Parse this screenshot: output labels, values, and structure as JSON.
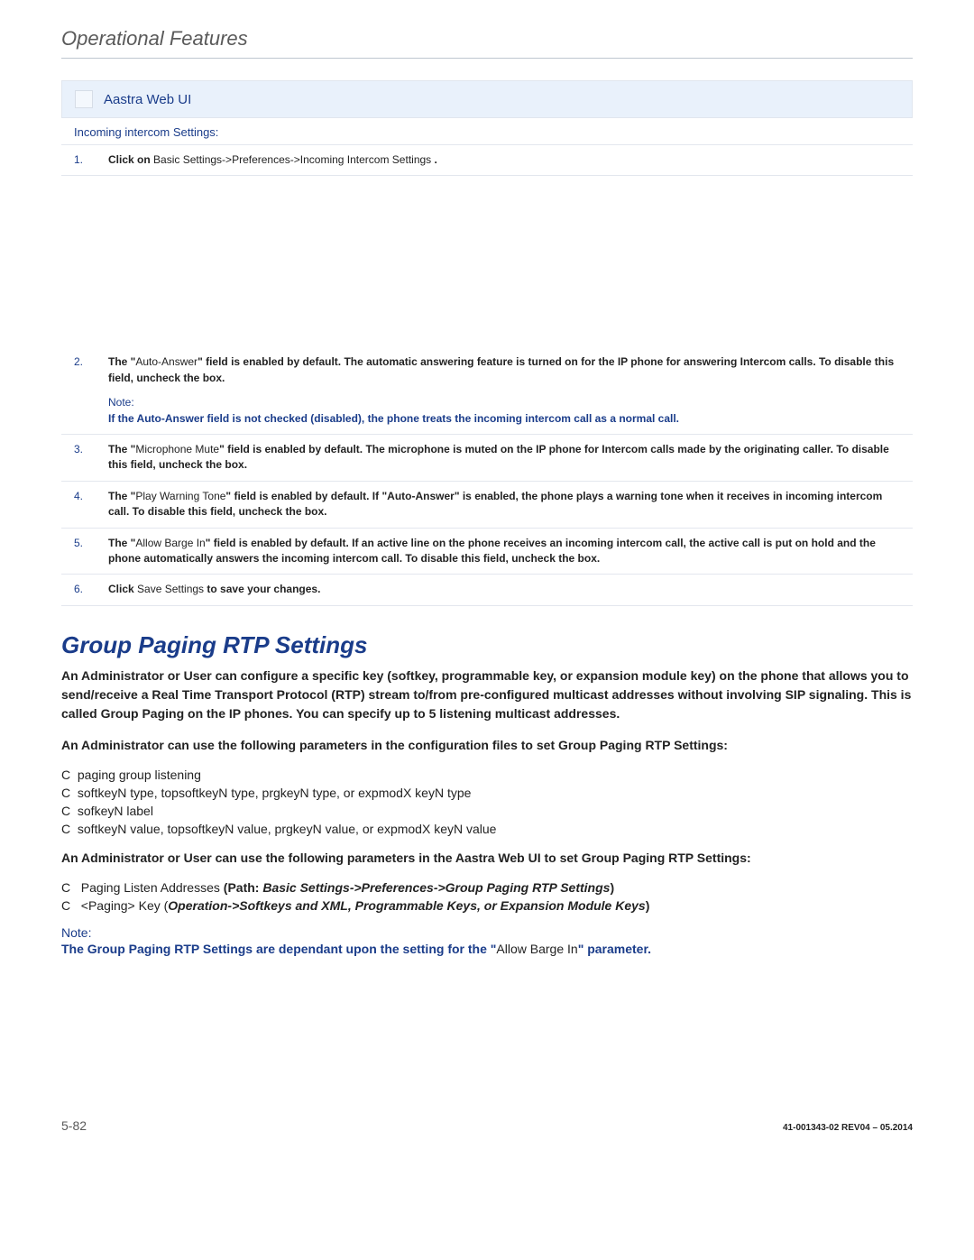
{
  "header": {
    "title": "Operational Features"
  },
  "panel": {
    "title": "Aastra Web UI",
    "subhead": "Incoming intercom Settings:"
  },
  "steps": [
    {
      "num": "1.",
      "html": "<b>Click on</b> Basic Settings->Preferences->Incoming Intercom Settings<b>&nbsp;.</b>"
    },
    {
      "num": "2.",
      "html": "<b>The \"</b>Auto-Answer<b>\" field is enabled by default. The automatic answering feature is turned on for the IP phone for answering Intercom calls. To disable this field, uncheck the box.</b>",
      "noteLabel": "Note:",
      "noteText": "If the Auto-Answer field is not checked (disabled), the phone treats the incoming intercom call as a normal call."
    },
    {
      "num": "3.",
      "html": "<b>The \"</b>Microphone Mute<b>\" field is enabled by default. The microphone is muted on the IP phone for Intercom calls made by the originating caller. To disable this field, uncheck the box.</b>"
    },
    {
      "num": "4.",
      "html": "<b>The \"</b>Play Warning Tone<b>\" field is enabled by default. If \"Auto-Answer\" is enabled, the phone plays a warning tone when it receives in incoming intercom call. To disable this field, uncheck the box.</b>"
    },
    {
      "num": "5.",
      "html": "<b>The \"</b>Allow Barge In<b>\" field is enabled by default. If an active line on the phone receives an incoming intercom call, the active call is put on hold and the phone automatically answers the incoming intercom call. To disable this field, uncheck the box.</b>"
    },
    {
      "num": "6.",
      "html": "<b>Click </b>Save Settings<b> to save your changes.</b>"
    }
  ],
  "section": {
    "title": "Group Paging RTP Settings"
  },
  "para1": "An Administrator or User can configure a specific key (softkey, programmable key, or expansion module key) on the phone that allows you to send/receive a Real Time Transport Protocol (RTP) stream to/from pre-configured multicast addresses without involving SIP signaling. This is called Group Paging on the IP phones. You can specify up to 5 listening multicast addresses.",
  "para2": "An Administrator can use the following parameters in the configuration files to set Group Paging RTP Settings:",
  "bullets1": [
    "paging group listening",
    "softkeyN type, topsoftkeyN type, prgkeyN type, or expmodX keyN type",
    "sofkeyN label",
    "softkeyN value, topsoftkeyN value, prgkeyN value, or expmodX keyN value"
  ],
  "para3": "An Administrator or User can use the following parameters in the Aastra Web UI to set Group Paging RTP Settings:",
  "bullets2": [
    {
      "pre": "Paging Listen Addresses   ",
      "label": "(Path: ",
      "path": "Basic Settings->Preferences->Group Paging RTP Settings",
      "post": ")"
    },
    {
      "pre": "<Paging> Key  (",
      "path": "Operation->Softkeys and XML, Programmable Keys, or Expansion Module Keys",
      "post": ")"
    }
  ],
  "note2": {
    "label": "Note:",
    "part1": "The Group Paging RTP Settings are dependant upon the setting for the \"",
    "mid": "Allow Barge In",
    "part2": "\" parameter."
  },
  "footer": {
    "left": "5-82",
    "right": "41-001343-02 REV04 – 05.2014"
  }
}
